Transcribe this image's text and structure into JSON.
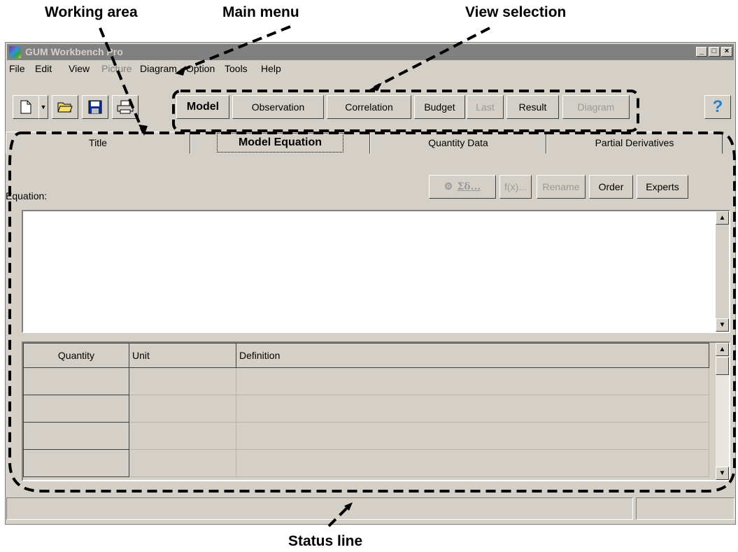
{
  "callouts": {
    "working_area": "Working area",
    "main_menu": "Main menu",
    "view_selection": "View selection",
    "status_line": "Status line"
  },
  "window": {
    "title": "GUM Workbench Pro",
    "controls": {
      "minimize": "_",
      "maximize": "□",
      "close": "×"
    }
  },
  "menu": {
    "items": [
      {
        "label": "File",
        "enabled": true
      },
      {
        "label": "Edit",
        "enabled": true
      },
      {
        "label": "View",
        "enabled": true
      },
      {
        "label": "Picture",
        "enabled": false
      },
      {
        "label": "Diagram",
        "enabled": true
      },
      {
        "label": "Option",
        "enabled": true
      },
      {
        "label": "Tools",
        "enabled": true
      },
      {
        "label": "Help",
        "enabled": true
      }
    ]
  },
  "toolbar": {
    "icons": [
      "new-file-icon",
      "dropdown-arrow-icon",
      "open-folder-icon",
      "save-disk-icon",
      "print-icon"
    ],
    "views": [
      {
        "label": "Model",
        "enabled": true
      },
      {
        "label": "Observation",
        "enabled": true
      },
      {
        "label": "Correlation",
        "enabled": true
      },
      {
        "label": "Budget",
        "enabled": true
      },
      {
        "label": "Last",
        "enabled": false
      },
      {
        "label": "Result",
        "enabled": true
      },
      {
        "label": "Diagram",
        "enabled": false
      }
    ],
    "help_symbol": "?"
  },
  "tabs": [
    {
      "label": "Title",
      "active": false
    },
    {
      "label": "Model Equation",
      "active": true
    },
    {
      "label": "Quantity Data",
      "active": false
    },
    {
      "label": "Partial Derivatives",
      "active": false
    }
  ],
  "equation": {
    "label": "Equation:",
    "buttons": [
      {
        "label": "Σδ...",
        "enabled": false
      },
      {
        "label": "f(x)...",
        "enabled": false
      },
      {
        "label": "Rename",
        "enabled": false
      },
      {
        "label": "Order",
        "enabled": true
      },
      {
        "label": "Experts",
        "enabled": true
      }
    ],
    "value": ""
  },
  "quantity_table": {
    "columns": [
      "Quantity",
      "Unit",
      "Definition"
    ],
    "rows": [
      [
        "",
        "",
        ""
      ],
      [
        "",
        "",
        ""
      ],
      [
        "",
        "",
        ""
      ],
      [
        "",
        "",
        ""
      ]
    ]
  },
  "colors": {
    "face": "#d4d0c8",
    "titlebar_inactive": "#808080",
    "help": "#1f7fd0"
  }
}
